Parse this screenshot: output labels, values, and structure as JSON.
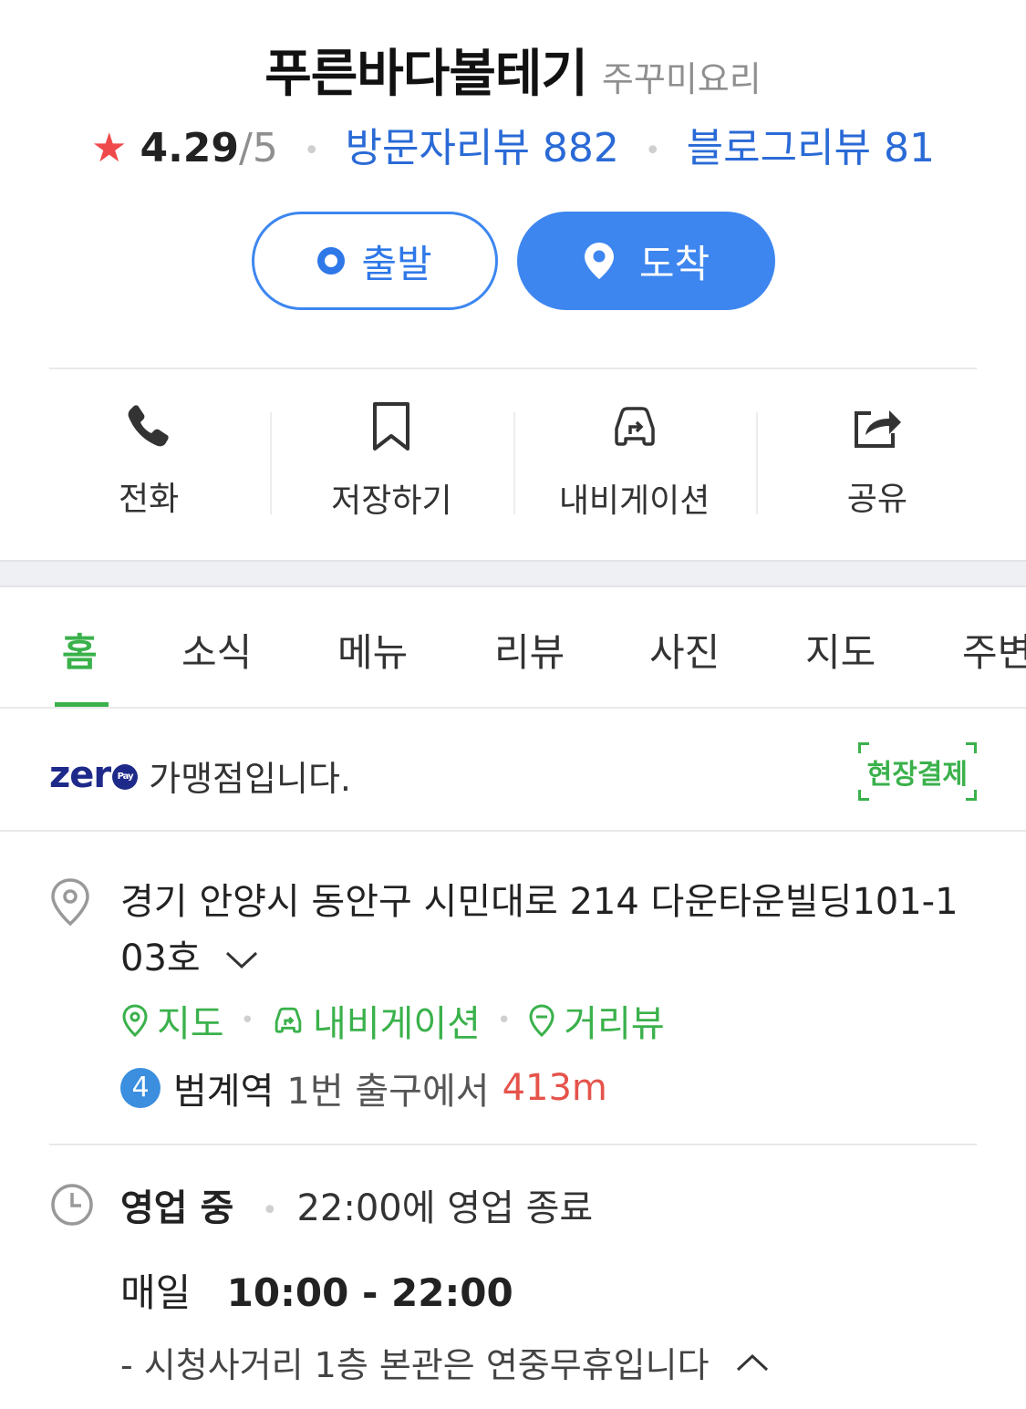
{
  "header": {
    "title": "푸른바다볼테기",
    "category": "주꾸미요리"
  },
  "rating": {
    "score": "4.29",
    "out_of": "/5",
    "visitor_reviews": "방문자리뷰 882",
    "blog_reviews": "블로그리뷰 81"
  },
  "route": {
    "start_label": "출발",
    "arrive_label": "도착"
  },
  "actions": [
    {
      "label": "전화",
      "icon": "phone-icon"
    },
    {
      "label": "저장하기",
      "icon": "bookmark-icon"
    },
    {
      "label": "내비게이션",
      "icon": "car-navigation-icon"
    },
    {
      "label": "공유",
      "icon": "share-icon"
    }
  ],
  "tabs": [
    "홈",
    "소식",
    "메뉴",
    "리뷰",
    "사진",
    "지도",
    "주변"
  ],
  "active_tab": "홈",
  "zeropay": {
    "logo": "zer",
    "pay": "Pay",
    "text": "가맹점입니다.",
    "badge": "현장결제"
  },
  "address": {
    "text": "경기 안양시 동안구 시민대로 214 다운타운빌딩101-103호",
    "links": [
      "지도",
      "내비게이션",
      "거리뷰"
    ]
  },
  "subway": {
    "line": "4",
    "station": "범계역",
    "exit": "1번 출구에서",
    "distance": "413m"
  },
  "hours": {
    "status": "영업 중",
    "close_info": "22:00에 영업 종료",
    "day": "매일",
    "time": "10:00 - 22:00",
    "note": "- 시청사거리 1층 본관은 연중무휴입니다"
  },
  "colors": {
    "primary_blue": "#3d86f0",
    "link_blue": "#2a6ad6",
    "green": "#3ab14b",
    "star_red": "#f0494b",
    "distance_red": "#e5534b",
    "zeropay_navy": "#1e2a8a"
  }
}
